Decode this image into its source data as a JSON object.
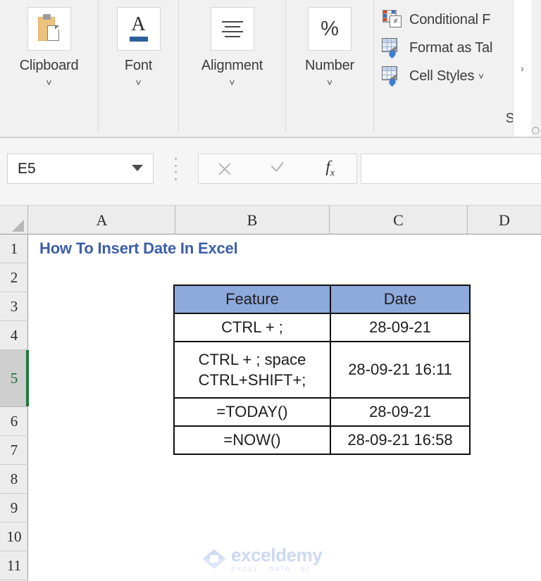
{
  "ribbon": {
    "groups": [
      {
        "label": "Clipboard",
        "icon": "clipboard-icon",
        "has_caret": true
      },
      {
        "label": "Font",
        "icon": "font-a-icon",
        "has_caret": true
      },
      {
        "label": "Alignment",
        "icon": "alignment-lines-icon",
        "has_caret": true
      },
      {
        "label": "Number",
        "icon": "percent-icon",
        "has_caret": true
      }
    ],
    "styles": {
      "caption": "Style",
      "items": [
        {
          "label": "Conditional F",
          "icon": "conditional-formatting-icon",
          "has_caret": false
        },
        {
          "label": "Format as Tal",
          "icon": "format-as-table-icon",
          "has_caret": false
        },
        {
          "label": "Cell Styles",
          "icon": "cell-styles-icon",
          "has_caret": true
        }
      ]
    },
    "expand_chevron": "›",
    "dialog_launcher": "⌟"
  },
  "formula_bar": {
    "name_box_value": "E5",
    "name_box_dropdown": "dropdown-arrow-icon",
    "cancel_icon": "cancel-x-icon",
    "confirm_icon": "confirm-check-icon",
    "function_icon": "fx-insert-function-icon",
    "formula_value": ""
  },
  "grid": {
    "columns": [
      "A",
      "B",
      "C",
      "D"
    ],
    "rows": [
      "1",
      "2",
      "3",
      "4",
      "5",
      "6",
      "7",
      "8",
      "9",
      "10",
      "11"
    ],
    "selected_row": "5",
    "selected_cell": "E5",
    "title_cell": {
      "ref": "A1",
      "text": "How To Insert Date In Excel",
      "color": "#3B5EA8"
    }
  },
  "data_table": {
    "header_fill": "#8EA9DB",
    "headers": [
      "Feature",
      "Date"
    ],
    "rows": [
      {
        "feature": "CTRL + ;",
        "feature_lines": [
          "CTRL + ;"
        ],
        "date": "28-09-21",
        "tall": false
      },
      {
        "feature": "CTRL + ; space CTRL+SHIFT+;",
        "feature_lines": [
          "CTRL + ; space",
          "CTRL+SHIFT+;"
        ],
        "date": "28-09-21 16:11",
        "tall": true
      },
      {
        "feature": "=TODAY()",
        "feature_lines": [
          "=TODAY()"
        ],
        "date": "28-09-21",
        "tall": false
      },
      {
        "feature": "=NOW()",
        "feature_lines": [
          "=NOW()"
        ],
        "date": "28-09-21 16:58",
        "tall": false
      }
    ]
  },
  "watermark": {
    "name": "exceldemy",
    "tagline": "EXCEL · DATA · BI"
  }
}
